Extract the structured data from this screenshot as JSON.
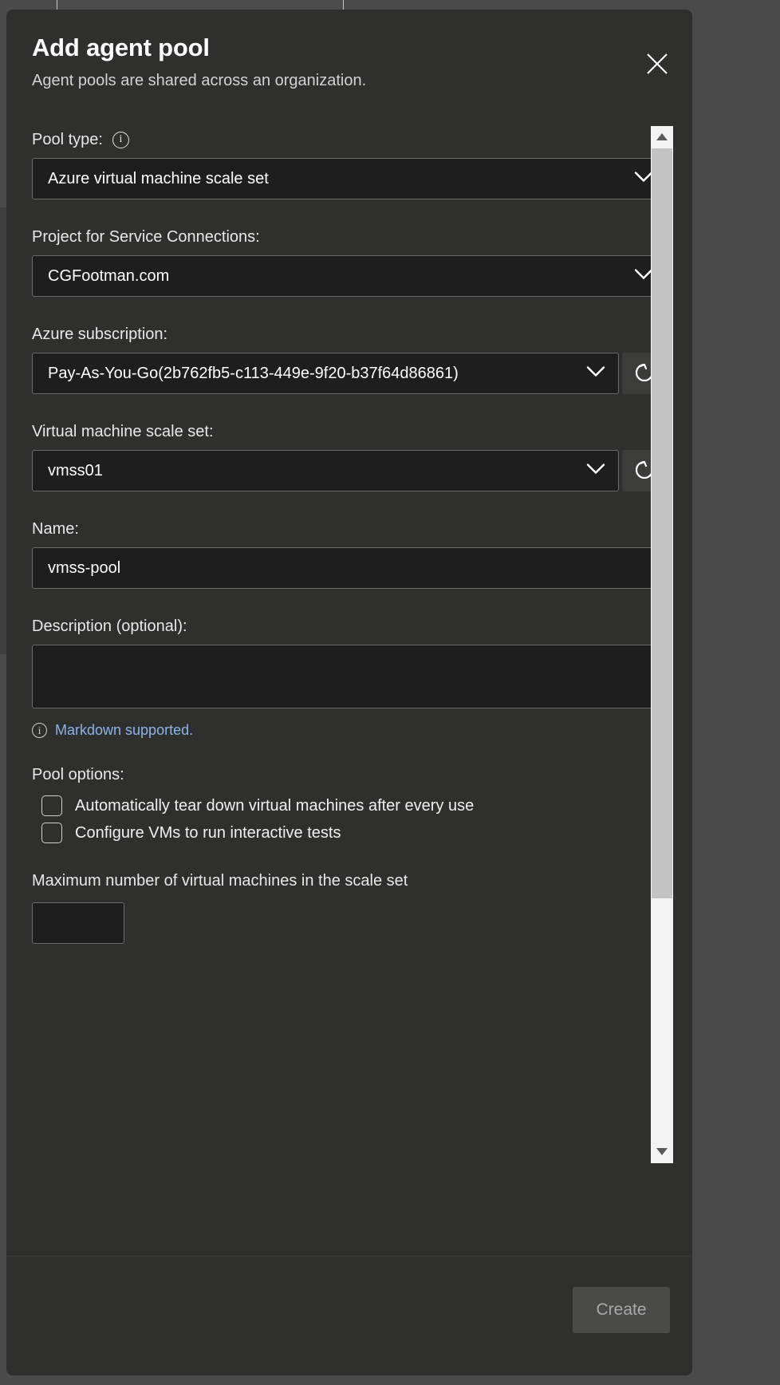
{
  "dialog": {
    "title": "Add agent pool",
    "subtitle": "Agent pools are shared across an organization.",
    "close_icon": "close-icon"
  },
  "fields": {
    "pool_type": {
      "label": "Pool type:",
      "info_icon": "info-icon",
      "value": "Azure virtual machine scale set",
      "chevron_icon": "chevron-down-icon"
    },
    "project_for_service_connections": {
      "label": "Project for Service Connections:",
      "value": "CGFootman.com",
      "chevron_icon": "chevron-down-icon"
    },
    "azure_subscription": {
      "label": "Azure subscription:",
      "value": "Pay-As-You-Go(2b762fb5-c113-449e-9f20-b37f64d86861)",
      "chevron_icon": "chevron-down-icon",
      "refresh_icon": "refresh-icon"
    },
    "virtual_machine_scale_set": {
      "label": "Virtual machine scale set:",
      "value": "vmss01",
      "chevron_icon": "chevron-down-icon",
      "refresh_icon": "refresh-icon"
    },
    "name": {
      "label": "Name:",
      "value": "vmss-pool",
      "placeholder": ""
    },
    "description": {
      "label": "Description (optional):",
      "value": "",
      "placeholder": "",
      "note_icon": "info-icon",
      "note_link": "Markdown supported."
    },
    "pool_options": {
      "label": "Pool options:",
      "items": [
        {
          "label": "Automatically tear down virtual machines after every use",
          "checked": false
        },
        {
          "label": "Configure VMs to run interactive tests",
          "checked": false
        }
      ]
    },
    "max_vms": {
      "label": "Maximum number of virtual machines in the scale set",
      "value": "",
      "placeholder": ""
    }
  },
  "scrollbar": {
    "up_icon": "triangle-up-icon",
    "down_icon": "triangle-down-icon"
  },
  "footer": {
    "create_label": "Create"
  },
  "colors": {
    "dialog_bg": "#2f2f2e",
    "input_bg": "#1f1e1e",
    "link": "#8cb4e8",
    "page_bg": "#4a4a4a"
  }
}
